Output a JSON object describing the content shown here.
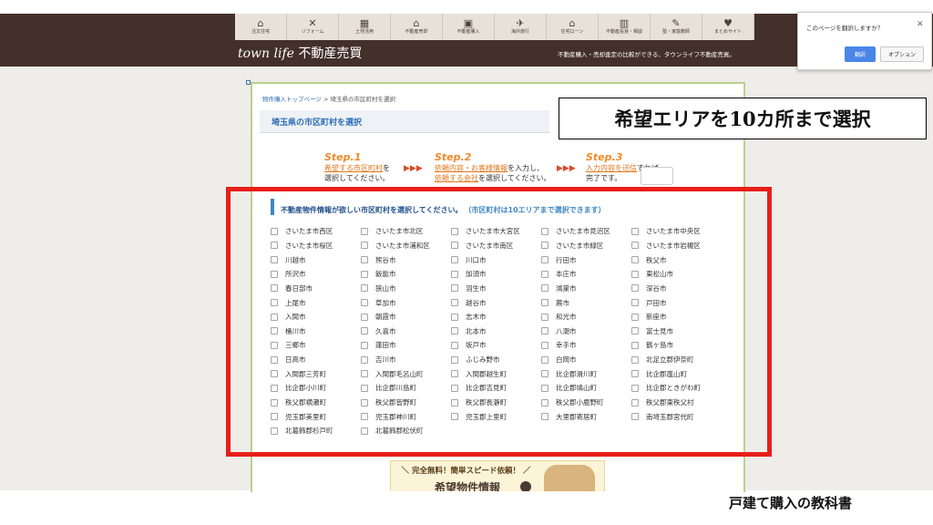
{
  "nav": [
    {
      "icon": "house-icon",
      "glyph": "⌂",
      "label": "注文住宅"
    },
    {
      "icon": "tools-icon",
      "glyph": "✕",
      "label": "リフォーム"
    },
    {
      "icon": "grid-land-icon",
      "glyph": "▦",
      "label": "土地活用"
    },
    {
      "icon": "people-house-icon",
      "glyph": "⌂",
      "label": "不動産売却"
    },
    {
      "icon": "building-icon",
      "glyph": "▣",
      "label": "不動産購入"
    },
    {
      "icon": "airplane-icon",
      "glyph": "✈",
      "label": "海外旅行"
    },
    {
      "icon": "home-loan-icon",
      "glyph": "⌂",
      "label": "住宅ローン"
    },
    {
      "icon": "investment-icon",
      "glyph": "▥",
      "label": "不動産投資・相談"
    },
    {
      "icon": "pencil-icon",
      "glyph": "✎",
      "label": "塾・家庭教師"
    },
    {
      "icon": "heart-icon",
      "glyph": "♥",
      "label": "まとめサイト"
    }
  ],
  "logo": {
    "brand": "town life",
    "name": " 不動産売買"
  },
  "tagline": "不動産購入・売却査定の比較ができる、タウンライフ不動産売買。",
  "breadcrumb": {
    "link": "物件購入トップページ",
    "sep": " > ",
    "current": "埼玉県の市区町村を選択"
  },
  "section_title": "埼玉県の市区町村を選択",
  "annotation": "希望エリアを10カ所まで選択",
  "steps": [
    {
      "head": "Step.1",
      "l1_hl": "希望する市区町村",
      "l1_rest": "を",
      "l2": "選択してください。"
    },
    {
      "head": "Step.2",
      "l1_hl": "依頼内容・お客様情報",
      "l1_rest": "を入力し、",
      "l2_hl": "依頼する会社",
      "l2": "を選択してください。"
    },
    {
      "head": "Step.3",
      "l1_hl": "入力内容を送信",
      "l1_rest": "すれば",
      "l2": "完了です。"
    }
  ],
  "step_arrow": "▶▶▶",
  "instruction": {
    "label": "不動産物件情報が欲しい市区町村を選択してください。",
    "note": "（市区町村は10エリアまで選択できます）"
  },
  "cities": [
    "さいたま市西区",
    "さいたま市北区",
    "さいたま市大宮区",
    "さいたま市見沼区",
    "さいたま市中央区",
    "さいたま市桜区",
    "さいたま市浦和区",
    "さいたま市南区",
    "さいたま市緑区",
    "さいたま市岩槻区",
    "川越市",
    "熊谷市",
    "川口市",
    "行田市",
    "秩父市",
    "所沢市",
    "飯能市",
    "加須市",
    "本庄市",
    "東松山市",
    "春日部市",
    "狭山市",
    "羽生市",
    "鴻巣市",
    "深谷市",
    "上尾市",
    "草加市",
    "越谷市",
    "蕨市",
    "戸田市",
    "入間市",
    "朝霞市",
    "志木市",
    "和光市",
    "新座市",
    "桶川市",
    "久喜市",
    "北本市",
    "八潮市",
    "富士見市",
    "三郷市",
    "蓮田市",
    "坂戸市",
    "幸手市",
    "鶴ヶ島市",
    "日高市",
    "吉川市",
    "ふじみ野市",
    "白岡市",
    "北足立郡伊奈町",
    "入間郡三芳町",
    "入間郡毛呂山町",
    "入間郡越生町",
    "比企郡滑川町",
    "比企郡嵐山町",
    "比企郡小川町",
    "比企郡川島町",
    "比企郡吉見町",
    "比企郡鳩山町",
    "比企郡ときがわ町",
    "秩父郡横瀬町",
    "秩父郡皆野町",
    "秩父郡長瀞町",
    "秩父郡小鹿野町",
    "秩父郡東秩父村",
    "児玉郡美里町",
    "児玉郡神川町",
    "児玉郡上里町",
    "大里郡寄居町",
    "南埼玉郡宮代町",
    "北葛飾郡杉戸町",
    "北葛飾郡松伏町"
  ],
  "banner": {
    "line1": "＼ 完全無料！簡単スピード依頼！ ／",
    "line2": "希望物件情報"
  },
  "footer_text": "戸建て購入の教科書",
  "translate": {
    "question": "このページを翻訳しますか？",
    "translate_label": "翻訳",
    "options_label": "オプション"
  }
}
